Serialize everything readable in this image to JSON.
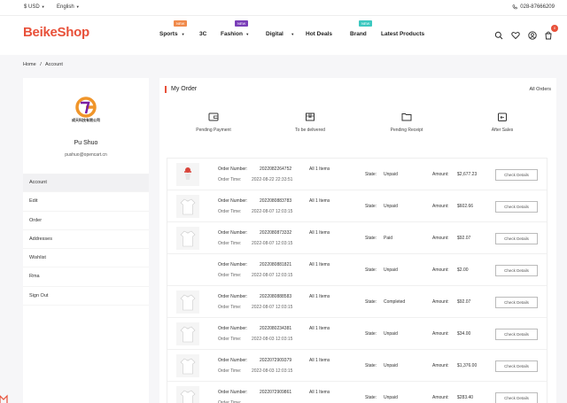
{
  "topbar": {
    "currency": "$ USD",
    "language": "English",
    "phone": "028-87666209"
  },
  "header": {
    "logo": "BeikeShop",
    "nav": [
      {
        "label": "Sports",
        "caret": true,
        "badge": "NEW",
        "badge_color": "#f08a4b"
      },
      {
        "label": "3C",
        "caret": false,
        "badge": null
      },
      {
        "label": "Fashion",
        "caret": true,
        "badge": "NEW",
        "badge_color": "#7a3eb8"
      },
      {
        "label": "Digital",
        "caret": true,
        "badge": null
      },
      {
        "label": "Hot Deals",
        "caret": false,
        "badge": null
      },
      {
        "label": "Brand",
        "caret": false,
        "badge": "NEW",
        "badge_color": "#3cc8c0"
      },
      {
        "label": "Latest Products",
        "caret": false,
        "badge": null
      }
    ],
    "cart_count": "0"
  },
  "breadcrumb": {
    "home": "Home",
    "separator": "/",
    "current": "Account"
  },
  "sidebar": {
    "avatar_text": "成天科技有限公司",
    "user_name": "Pu Shuo",
    "user_email": "pushuo@opencart.cn",
    "menu": [
      "Account",
      "Edit",
      "Order",
      "Addresses",
      "Wishlist",
      "Rma",
      "Sign Out"
    ]
  },
  "main": {
    "title": "My Order",
    "all_orders": "All Orders",
    "statuses": [
      "Pending Payment",
      "To be delivered",
      "Pending Receipt",
      "After Sales"
    ],
    "order_number_label": "Order Number:",
    "order_time_label": "Order Time:",
    "state_label": "State:",
    "amount_label": "Amount:",
    "check_label": "Check Details",
    "orders": [
      {
        "number": "2022082264752",
        "time": "2022-08-22 22:33:51",
        "items": "All 1 Items",
        "state": "Unpaid",
        "amount": "$2,677.23",
        "thumb": "red"
      },
      {
        "number": "2022080883783",
        "time": "2022-08-07 12:03:15",
        "items": "All 1 Items",
        "state": "Unpaid",
        "amount": "$602.66",
        "thumb": "shirt"
      },
      {
        "number": "2022080873332",
        "time": "2022-08-07 12:03:15",
        "items": "All 1 Items",
        "state": "Paid",
        "amount": "$92.07",
        "thumb": "shirt"
      },
      {
        "number": "2022080881821",
        "time": "2022-08-07 12:03:15",
        "items": "All 1 Items",
        "state": "Unpaid",
        "amount": "$2.00",
        "thumb": "none"
      },
      {
        "number": "2022080888583",
        "time": "2022-08-07 12:03:15",
        "items": "All 1 Items",
        "state": "Completed",
        "amount": "$92.07",
        "thumb": "shirt"
      },
      {
        "number": "2022080234381",
        "time": "2022-08-03 12:03:15",
        "items": "All 1 Items",
        "state": "Unpaid",
        "amount": "$34.00",
        "thumb": "shirt"
      },
      {
        "number": "2022072909379",
        "time": "2022-08-03 12:03:15",
        "items": "All 1 Items",
        "state": "Unpaid",
        "amount": "$1,376.00",
        "thumb": "shirt"
      },
      {
        "number": "2022072909861",
        "time": "",
        "items": "All 1 Items",
        "state": "Unpaid",
        "amount": "$283.40",
        "thumb": "shirt"
      }
    ]
  }
}
